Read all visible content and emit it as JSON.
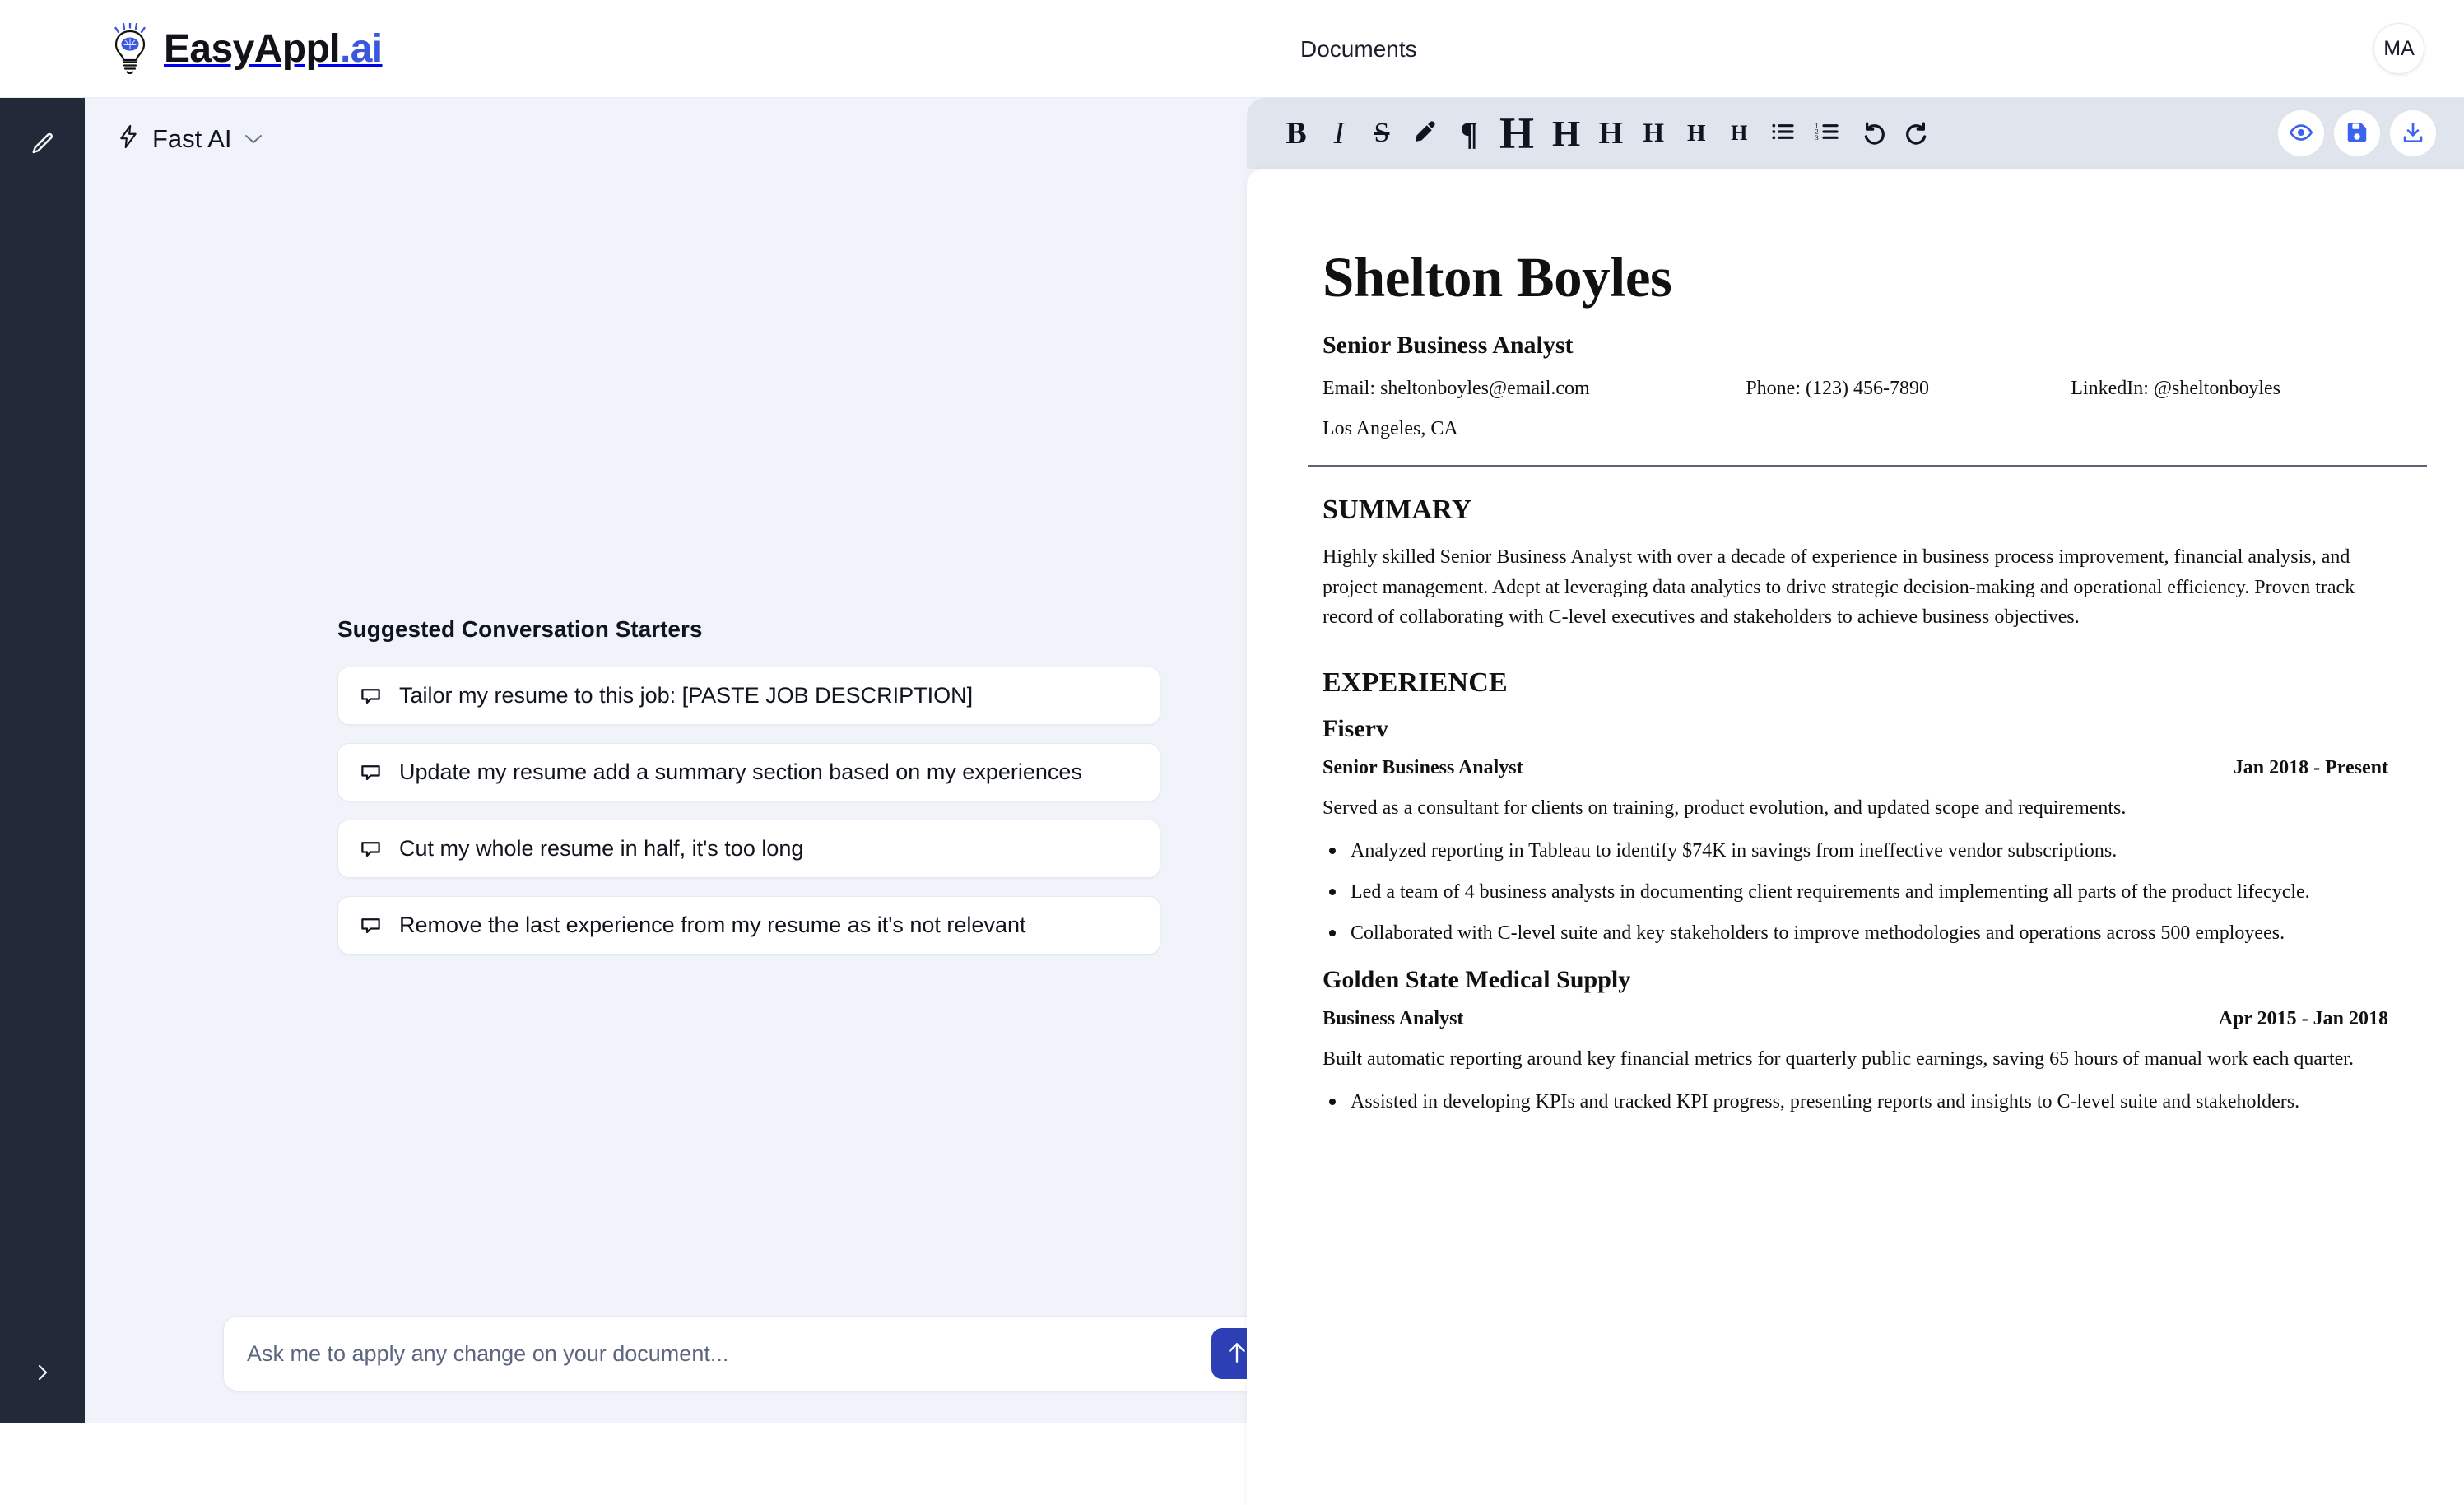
{
  "header": {
    "brand_name": "EasyAppl",
    "brand_suffix": ".ai",
    "brand_icon": "lightbulb-brain-icon",
    "nav_label": "Documents",
    "avatar_initials": "MA",
    "brand_accent_color": "#3b57de"
  },
  "rail": {
    "edit_icon": "pencil-icon",
    "expand_icon": "chevron-right-icon"
  },
  "chat": {
    "model": {
      "icon": "lightning-bolt-icon",
      "label": "Fast AI",
      "chevron": "chevron-down-icon"
    },
    "starters_title": "Suggested Conversation Starters",
    "starters": [
      {
        "icon": "speech-bubble-icon",
        "label": "Tailor my resume to this job: [PASTE JOB DESCRIPTION]"
      },
      {
        "icon": "speech-bubble-icon",
        "label": "Update my resume add a summary section based on my experiences"
      },
      {
        "icon": "speech-bubble-icon",
        "label": "Cut my whole resume in half, it's too long"
      },
      {
        "icon": "speech-bubble-icon",
        "label": "Remove the last experience from my resume as it's not relevant"
      }
    ],
    "composer": {
      "placeholder": "Ask me to apply any change on your document...",
      "value": "",
      "send_icon": "arrow-up-icon",
      "send_color": "#2d3fb5"
    }
  },
  "toolbar": {
    "bold": "B",
    "italic": "I",
    "strike": "S",
    "highlighter_icon": "highlighter-pen-icon",
    "paragraph": "¶",
    "headings": [
      "H",
      "H",
      "H",
      "H",
      "H",
      "H"
    ],
    "bullet_list_icon": "bullet-list-icon",
    "ordered_list_icon": "ordered-list-icon",
    "undo_icon": "undo-icon",
    "redo_icon": "redo-icon",
    "preview_icon": "eye-icon",
    "save_icon": "save-floppy-icon",
    "download_icon": "download-icon",
    "accent_color": "#3b63f0",
    "background_color": "#dfe4ed"
  },
  "resume": {
    "name": "Shelton Boyles",
    "title": "Senior Business Analyst",
    "email": "Email: sheltonboyles@email.com",
    "phone": "Phone: (123) 456-7890",
    "linkedin": "LinkedIn: @sheltonboyles",
    "location": "Los Angeles, CA",
    "summary_heading": "SUMMARY",
    "summary_text": "Highly skilled Senior Business Analyst with over a decade of experience in business process improvement, financial analysis, and project management. Adept at leveraging data analytics to drive strategic decision-making and operational efficiency. Proven track record of collaborating with C-level executives and stakeholders to achieve business objectives.",
    "experience_heading": "EXPERIENCE",
    "jobs": [
      {
        "company": "Fiserv",
        "role": "Senior Business Analyst",
        "dates": "Jan 2018 - Present",
        "description": "Served as a consultant for clients on training, product evolution, and updated scope and requirements.",
        "bullets": [
          "Analyzed reporting in Tableau to identify $74K in savings from ineffective vendor subscriptions.",
          "Led a team of 4 business analysts in documenting client requirements and implementing all parts of the product lifecycle.",
          "Collaborated with C-level suite and key stakeholders to improve methodologies and operations across 500 employees."
        ]
      },
      {
        "company": "Golden State Medical Supply",
        "role": "Business Analyst",
        "dates": "Apr 2015 - Jan 2018",
        "description": "Built automatic reporting around key financial metrics for quarterly public earnings, saving 65 hours of manual work each quarter.",
        "bullets": [
          "Assisted in developing KPIs and tracked KPI progress, presenting reports and insights to C-level suite and stakeholders."
        ]
      }
    ]
  }
}
